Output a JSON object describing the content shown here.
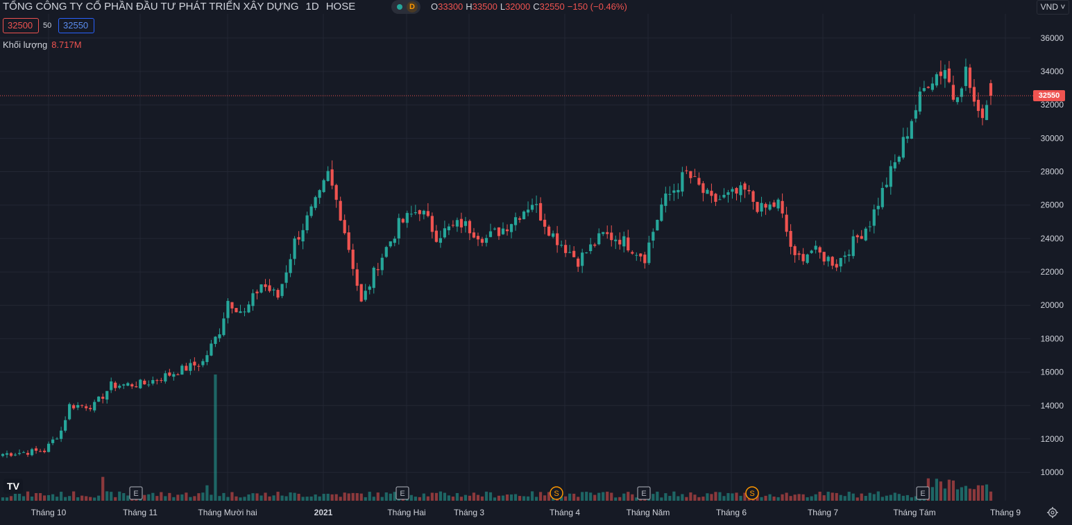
{
  "header": {
    "title": "TỔNG CÔNG TY CỔ PHẦN ĐẦU TƯ PHÁT TRIỂN XÂY DỰNG",
    "interval": "1D",
    "exchange": "HOSE",
    "delay_badge": "D",
    "ohlc": {
      "o_label": "O",
      "o_value": "33300",
      "h_label": "H",
      "h_value": "33500",
      "l_label": "L",
      "l_value": "32000",
      "c_label": "C",
      "c_value": "32550",
      "change": "−150 (−0.46%)"
    }
  },
  "bid_ask": {
    "bid": "32500",
    "spread": "50",
    "ask": "32550"
  },
  "volume_legend": {
    "label": "Khối lượng",
    "value": "8.717M"
  },
  "currency": "VND",
  "last_price": "32550",
  "logo_text": "TV",
  "colors": {
    "up": "#26a69a",
    "down": "#ef5350",
    "background": "#161a25",
    "grid": "#232734"
  },
  "chart_data": {
    "type": "candlestick",
    "y_axis_ticks": [
      10000,
      12000,
      14000,
      16000,
      18000,
      20000,
      22000,
      24000,
      26000,
      28000,
      30000,
      32000,
      34000,
      36000
    ],
    "ylim": [
      8800,
      36700
    ],
    "x_axis_labels": [
      "Tháng 10",
      "Tháng 11",
      "Tháng Mười hai",
      "2021",
      "Tháng Hai",
      "Tháng 3",
      "Tháng 4",
      "Tháng Năm",
      "Tháng 6",
      "Tháng 7",
      "Tháng Tám",
      "Tháng 9"
    ],
    "events": [
      "E",
      "E",
      "S",
      "E",
      "S",
      "E"
    ],
    "price_path": [
      [
        0,
        11100
      ],
      [
        10,
        11300
      ],
      [
        14,
        12500
      ],
      [
        16,
        14000
      ],
      [
        22,
        14000
      ],
      [
        26,
        15200
      ],
      [
        34,
        15300
      ],
      [
        37,
        15600
      ],
      [
        48,
        16600
      ],
      [
        52,
        18500
      ],
      [
        54,
        20300
      ],
      [
        58,
        19500
      ],
      [
        62,
        21300
      ],
      [
        66,
        20500
      ],
      [
        70,
        23800
      ],
      [
        76,
        26500
      ],
      [
        78,
        27800
      ],
      [
        81,
        25500
      ],
      [
        84,
        22400
      ],
      [
        86,
        20100
      ],
      [
        90,
        22500
      ],
      [
        95,
        24800
      ],
      [
        100,
        25800
      ],
      [
        104,
        24200
      ],
      [
        110,
        24900
      ],
      [
        116,
        24000
      ],
      [
        120,
        24600
      ],
      [
        127,
        26200
      ],
      [
        132,
        24200
      ],
      [
        138,
        22700
      ],
      [
        144,
        24200
      ],
      [
        148,
        24000
      ],
      [
        154,
        22900
      ],
      [
        158,
        26000
      ],
      [
        164,
        27900
      ],
      [
        170,
        26200
      ],
      [
        178,
        26800
      ],
      [
        182,
        25700
      ],
      [
        186,
        26100
      ],
      [
        190,
        22700
      ],
      [
        194,
        23300
      ],
      [
        200,
        22500
      ],
      [
        208,
        25000
      ],
      [
        212,
        27400
      ],
      [
        215,
        29000
      ],
      [
        218,
        31200
      ],
      [
        222,
        33500
      ],
      [
        226,
        34200
      ],
      [
        228,
        32500
      ],
      [
        231,
        34000
      ],
      [
        234,
        31200
      ],
      [
        237,
        32550
      ]
    ],
    "volume_spikes": [
      {
        "index": 24,
        "value": 6800000
      },
      {
        "index": 51,
        "value": 36000000
      },
      {
        "index": 49,
        "value": 4400000
      }
    ],
    "volume_base": 1800000,
    "last_volume": 8717000
  }
}
